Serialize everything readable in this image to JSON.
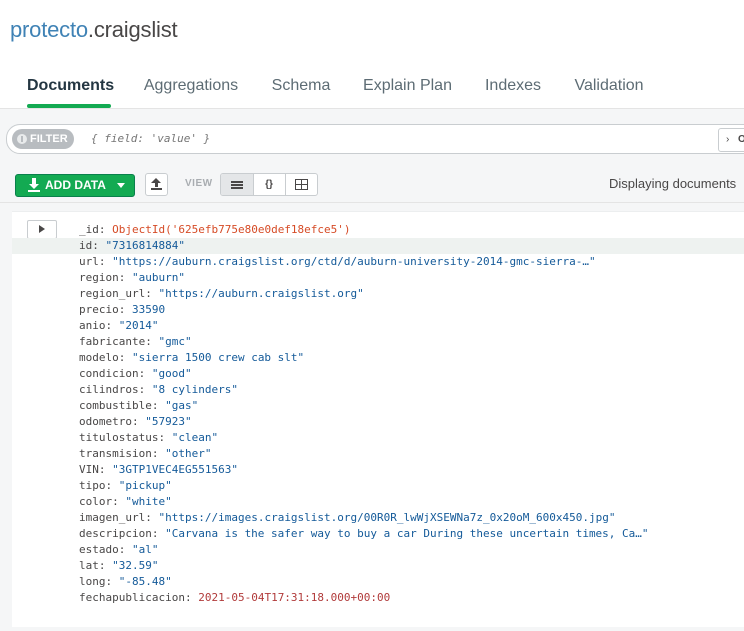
{
  "header": {
    "db_name": "protecto",
    "separator": ".",
    "collection_name": "craigslist"
  },
  "tabs": [
    {
      "label": "Documents",
      "active": true
    },
    {
      "label": "Aggregations",
      "active": false
    },
    {
      "label": "Schema",
      "active": false
    },
    {
      "label": "Explain Plan",
      "active": false
    },
    {
      "label": "Indexes",
      "active": false
    },
    {
      "label": "Validation",
      "active": false
    }
  ],
  "filter": {
    "pill_label": "FILTER",
    "placeholder": "{ field: 'value' }",
    "options_label": "O"
  },
  "toolbar": {
    "add_data_label": "ADD DATA",
    "view_label": "VIEW",
    "view_modes": [
      "list",
      "json",
      "table"
    ],
    "json_view_label": "{}",
    "display_text": "Displaying documents"
  },
  "document": {
    "fields": [
      {
        "name": "_id: ",
        "value": "ObjectId('625efb775e80e0def18efce5')",
        "kind": "oid"
      },
      {
        "name": "id: ",
        "value": "\"7316814884\"",
        "kind": "string"
      },
      {
        "name": "url: ",
        "value": "\"https://auburn.craigslist.org/ctd/d/auburn-university-2014-gmc-sierra-…\"",
        "kind": "string"
      },
      {
        "name": "region: ",
        "value": "\"auburn\"",
        "kind": "string"
      },
      {
        "name": "region_url: ",
        "value": "\"https://auburn.craigslist.org\"",
        "kind": "string"
      },
      {
        "name": "precio: ",
        "value": "33590",
        "kind": "number"
      },
      {
        "name": "anio: ",
        "value": "\"2014\"",
        "kind": "string"
      },
      {
        "name": "fabricante: ",
        "value": "\"gmc\"",
        "kind": "string"
      },
      {
        "name": "modelo: ",
        "value": "\"sierra 1500 crew cab slt\"",
        "kind": "string"
      },
      {
        "name": "condicion: ",
        "value": "\"good\"",
        "kind": "string"
      },
      {
        "name": "cilindros: ",
        "value": "\"8 cylinders\"",
        "kind": "string"
      },
      {
        "name": "combustible: ",
        "value": "\"gas\"",
        "kind": "string"
      },
      {
        "name": "odometro: ",
        "value": "\"57923\"",
        "kind": "string"
      },
      {
        "name": "titulostatus: ",
        "value": "\"clean\"",
        "kind": "string"
      },
      {
        "name": "transmision: ",
        "value": "\"other\"",
        "kind": "string"
      },
      {
        "name": "VIN: ",
        "value": "\"3GTP1VEC4EG551563\"",
        "kind": "string"
      },
      {
        "name": "tipo: ",
        "value": "\"pickup\"",
        "kind": "string"
      },
      {
        "name": "color: ",
        "value": "\"white\"",
        "kind": "string"
      },
      {
        "name": "imagen_url: ",
        "value": "\"https://images.craigslist.org/00R0R_lwWjXSEWNa7z_0x20oM_600x450.jpg\"",
        "kind": "string"
      },
      {
        "name": "descripcion: ",
        "value": "\"Carvana is the safer way to buy a car During these uncertain times, Ca…\"",
        "kind": "string"
      },
      {
        "name": "estado: ",
        "value": "\"al\"",
        "kind": "string"
      },
      {
        "name": "lat: ",
        "value": "\"32.59\"",
        "kind": "string"
      },
      {
        "name": "long: ",
        "value": "\"-85.48\"",
        "kind": "string"
      },
      {
        "name": "fechapublicacion: ",
        "value": "2021-05-04T17:31:18.000+00:00",
        "kind": "date"
      }
    ]
  },
  "colors": {
    "accent_green": "#13aa52",
    "db_name_blue": "#3f82b5",
    "string_value": "#145a99",
    "objectid_value": "#d64b26",
    "date_value": "#b13a3a"
  }
}
